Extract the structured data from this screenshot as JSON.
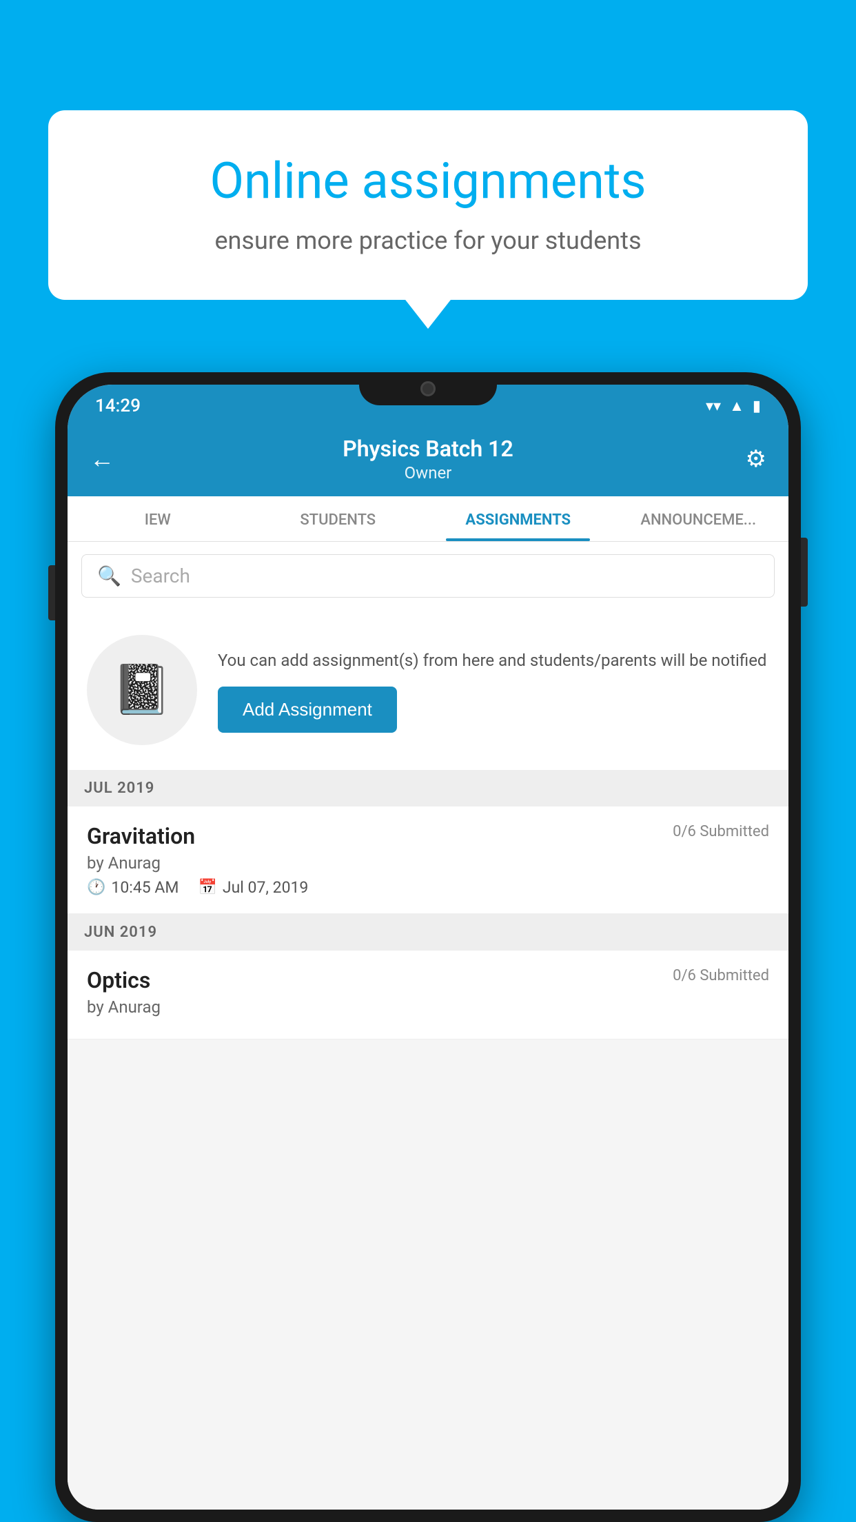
{
  "background": {
    "color": "#00AEEF"
  },
  "speech_bubble": {
    "title": "Online assignments",
    "subtitle": "ensure more practice for your students"
  },
  "status_bar": {
    "time": "14:29",
    "wifi_icon": "▾",
    "signal_icon": "▲",
    "battery_icon": "▮"
  },
  "header": {
    "title": "Physics Batch 12",
    "subtitle": "Owner",
    "back_icon": "←",
    "settings_icon": "⚙"
  },
  "tabs": [
    {
      "label": "IEW",
      "active": false
    },
    {
      "label": "STUDENTS",
      "active": false
    },
    {
      "label": "ASSIGNMENTS",
      "active": true
    },
    {
      "label": "ANNOUNCEMENTS",
      "active": false
    }
  ],
  "search": {
    "placeholder": "Search"
  },
  "info_card": {
    "icon": "📓",
    "text": "You can add assignment(s) from here and students/parents will be notified",
    "button_label": "Add Assignment"
  },
  "sections": [
    {
      "label": "JUL 2019",
      "assignments": [
        {
          "name": "Gravitation",
          "status": "0/6 Submitted",
          "author": "by Anurag",
          "time": "10:45 AM",
          "date": "Jul 07, 2019"
        }
      ]
    },
    {
      "label": "JUN 2019",
      "assignments": [
        {
          "name": "Optics",
          "status": "0/6 Submitted",
          "author": "by Anurag",
          "time": "",
          "date": ""
        }
      ]
    }
  ]
}
